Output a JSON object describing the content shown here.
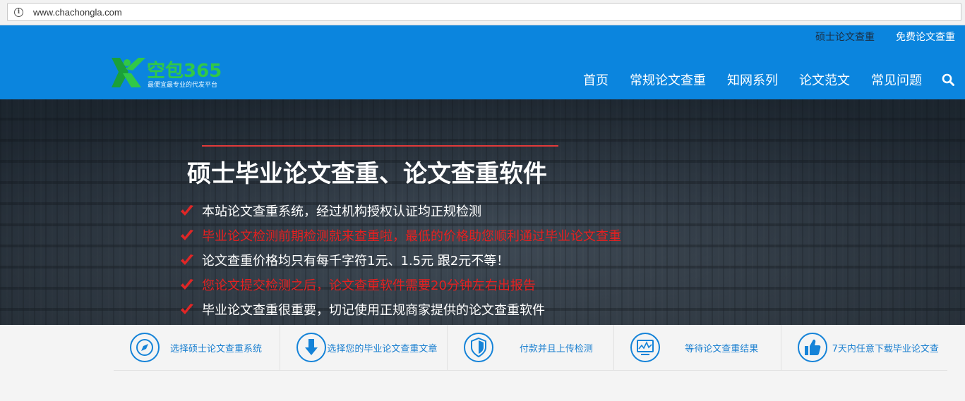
{
  "browser": {
    "url": "www.chachongla.com"
  },
  "header": {
    "top_links": [
      "硕士论文查重",
      "免费论文查重"
    ],
    "logo": {
      "name": "空包365",
      "slogan": "最便宜最专业的代发平台"
    },
    "nav": [
      "首页",
      "常规论文查重",
      "知网系列",
      "论文范文",
      "常见问题"
    ]
  },
  "hero": {
    "title": "硕士毕业论文查重、论文查重软件",
    "bullets": [
      {
        "text": "本站论文查重系统，经过机构授权认证均正规检测",
        "color": "#ffffff"
      },
      {
        "text": "毕业论文检测前期检测就来查重啦，最低的价格助您顺利通过毕业论文查重",
        "color": "#e52020"
      },
      {
        "text": "论文查重价格均只有每千字符1元、1.5元 跟2元不等！",
        "color": "#ffffff"
      },
      {
        "text": "您论文提交检测之后，论文查重软件需要20分钟左右出报告",
        "color": "#e52020"
      },
      {
        "text": "毕业论文查重很重要，切记使用正规商家提供的论文查重软件",
        "color": "#ffffff"
      }
    ]
  },
  "steps": [
    {
      "label": "选择硕士论文查重系统",
      "icon": "compass-icon"
    },
    {
      "label": "选择您的毕业论文查重文章",
      "icon": "download-icon"
    },
    {
      "label": "付款并且上传检测",
      "icon": "shield-icon"
    },
    {
      "label": "等待论文查重结果",
      "icon": "monitor-chart-icon"
    },
    {
      "label": "7天内任意下载毕业论文查",
      "icon": "thumbs-up-icon"
    }
  ],
  "colors": {
    "header_blue": "#0b85de",
    "logo_green": "#31c847",
    "accent_red": "#e52020",
    "step_blue": "#1583d8"
  }
}
